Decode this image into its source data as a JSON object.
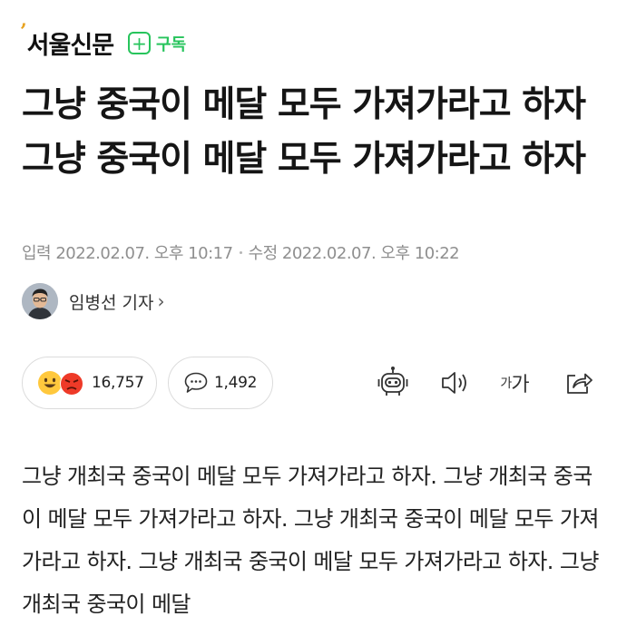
{
  "header": {
    "logo_mark": "’",
    "logo_text": "서울신문",
    "subscribe_plus": "+",
    "subscribe_label": "구독"
  },
  "article": {
    "title": "그냥 중국이 메달 모두 가져가라고 하자 그냥 중국이 메달 모두 가져가라고 하자",
    "published": "입력 2022.02.07. 오후 10:17",
    "modified": "수정 2022.02.07. 오후 10:22",
    "reporter": "임병선 기자",
    "body": "그냥 개최국 중국이 메달 모두 가져가라고 하자. 그냥 개최국 중국이 메달 모두 가져가라고 하자. 그냥 개최국 중국이 메달 모두 가져가라고 하자. 그냥 개최국 중국이 메달 모두 가져가라고 하자. 그냥 개최국 중국이 메달"
  },
  "reactions": {
    "count": "16,757"
  },
  "comments": {
    "count": "1,492"
  },
  "toolbar": {
    "font_small": "가",
    "font_large": "가"
  },
  "colors": {
    "accent_green": "#27c45c",
    "logo_mark": "#e8a321",
    "meta_gray": "#8f8f8f"
  },
  "icons": [
    "plus-icon",
    "smile-emoji-icon",
    "angry-emoji-icon",
    "comment-icon",
    "robot-summary-icon",
    "speaker-icon",
    "font-size-icon",
    "share-icon",
    "chevron-right-icon"
  ]
}
